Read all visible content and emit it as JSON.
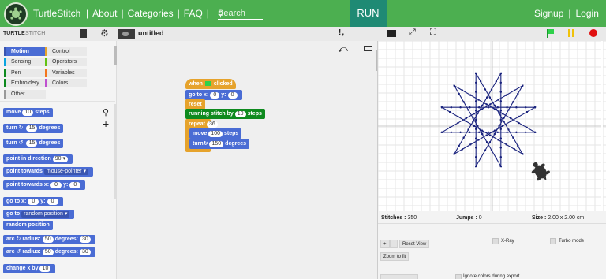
{
  "nav": {
    "brand": "TurtleStitch",
    "links": [
      "About",
      "Categories",
      "FAQ"
    ],
    "search_placeholder": "Search",
    "run_label": "RUN",
    "signup_label": "Signup",
    "login_label": "Login"
  },
  "toolbar": {
    "logo_text": "TURTLE",
    "logo_sub": "STITCH",
    "project_title": "untitled"
  },
  "palette": {
    "categories": [
      {
        "label": "Motion",
        "color": "#4a6cd4"
      },
      {
        "label": "Control",
        "color": "#e6a32c"
      },
      {
        "label": "Sensing",
        "color": "#0aa4e0"
      },
      {
        "label": "Operators",
        "color": "#62c213"
      },
      {
        "label": "Pen",
        "color": "#0e8a1e"
      },
      {
        "label": "Variables",
        "color": "#f3761d"
      },
      {
        "label": "Embroidery",
        "color": "#0e8a1e"
      },
      {
        "label": "Colors",
        "color": "#c050d0"
      },
      {
        "label": "Other",
        "color": "#999999"
      }
    ],
    "blocks": [
      {
        "text": "move",
        "slot": "10",
        "after": "steps"
      },
      {
        "text": "turn",
        "icon": "↻",
        "slot": "15",
        "after": "degrees"
      },
      {
        "text": "turn",
        "icon": "↺",
        "slot": "15",
        "after": "degrees"
      },
      {
        "text": "point in direction",
        "slot": "90 ▾"
      },
      {
        "text": "point towards",
        "dd": "mouse-pointer ▾"
      },
      {
        "text": "point towards x:",
        "slot": "0",
        "after": "y:",
        "slot2": "0"
      },
      {
        "text": "go to x:",
        "slot": "0",
        "after": "y:",
        "slot2": "0"
      },
      {
        "text": "go to",
        "dd": "random position ▾"
      },
      {
        "text": "random position"
      },
      {
        "text": "arc",
        "icon": "↻",
        "after0": "radius:",
        "slot": "50",
        "after": "degrees:",
        "slot2": "30"
      },
      {
        "text": "arc",
        "icon": "↺",
        "after0": "radius:",
        "slot": "50",
        "after": "degrees:",
        "slot2": "30"
      },
      {
        "text": "change x by",
        "slot": "10"
      }
    ]
  },
  "script": {
    "hat_when": "when",
    "hat_clicked": "clicked",
    "goto_label": "go to x:",
    "goto_x": "0",
    "goto_y_label": "y:",
    "goto_y": "0",
    "reset_label": "reset",
    "running_label": "running stitch by",
    "running_value": "10",
    "running_after": "steps",
    "repeat_label": "repeat",
    "repeat_value": "36",
    "move_label": "move",
    "move_value": "100",
    "move_after": "steps",
    "turn_label": "turn",
    "turn_icon": "↻",
    "turn_value": "150",
    "turn_after": "degrees"
  },
  "stage_info": {
    "stitches_label": "Stitches :",
    "stitches_value": "350",
    "jumps_label": "Jumps :",
    "jumps_value": "0",
    "size_label": "Size :",
    "size_value": "2.00 x 2.00 cm",
    "plus": "+",
    "minus": "-",
    "reset_view": "Reset View",
    "xray": "X-Ray",
    "turbo": "Turbo mode",
    "zoom_fit": "Zoom to fit",
    "ignore_colors": "Ignore colors during export"
  },
  "colors": {
    "nav_green": "#4caf50",
    "run_teal": "#1f8a74",
    "star_stroke": "#1a237e"
  }
}
